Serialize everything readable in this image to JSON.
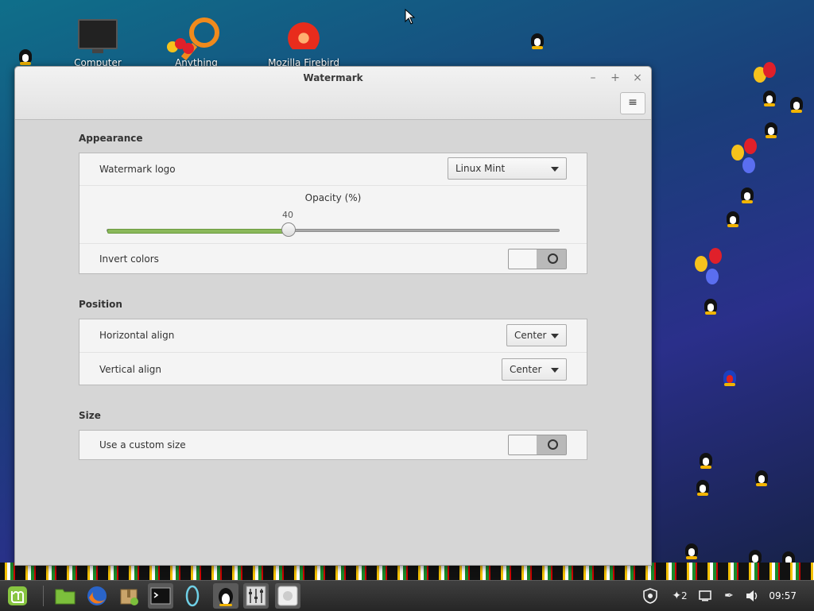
{
  "desktop": {
    "icons": [
      {
        "label": "Computer",
        "icon": "computer-icon"
      },
      {
        "label": "Anything",
        "icon": "search-tool-icon"
      },
      {
        "label": "Mozilla Firebird",
        "icon": "firebird-icon"
      }
    ],
    "wallpaper": "penguins-and-balloons"
  },
  "window": {
    "title": "Watermark",
    "controls": {
      "minimize": "–",
      "maximize": "+",
      "close": "×"
    },
    "menu_button": "≡",
    "sections": {
      "appearance": {
        "title": "Appearance",
        "logo_label": "Watermark logo",
        "logo_value": "Linux Mint",
        "opacity_label": "Opacity (%)",
        "opacity_value": "40",
        "opacity_fraction": 0.4,
        "invert_label": "Invert colors",
        "invert_on": false
      },
      "position": {
        "title": "Position",
        "horizontal_label": "Horizontal align",
        "horizontal_value": "Center",
        "vertical_label": "Vertical align",
        "vertical_value": "Center"
      },
      "size": {
        "title": "Size",
        "custom_label": "Use a custom size",
        "custom_on": false
      }
    }
  },
  "taskbar": {
    "launchers": [
      "menu-icon",
      "files-icon",
      "firefox-icon",
      "archive-manager-icon",
      "terminal-icon",
      "app-icon",
      "tux-icon",
      "mixer-icon",
      "app-window-icon"
    ],
    "tray": {
      "notification_count": "2",
      "clock": "09:57"
    }
  },
  "colors": {
    "accent_green": "#8ab85a",
    "window_bg": "#d6d6d6",
    "panel_bg": "#f4f4f4",
    "taskbar_bg": "#2e2e2e"
  }
}
